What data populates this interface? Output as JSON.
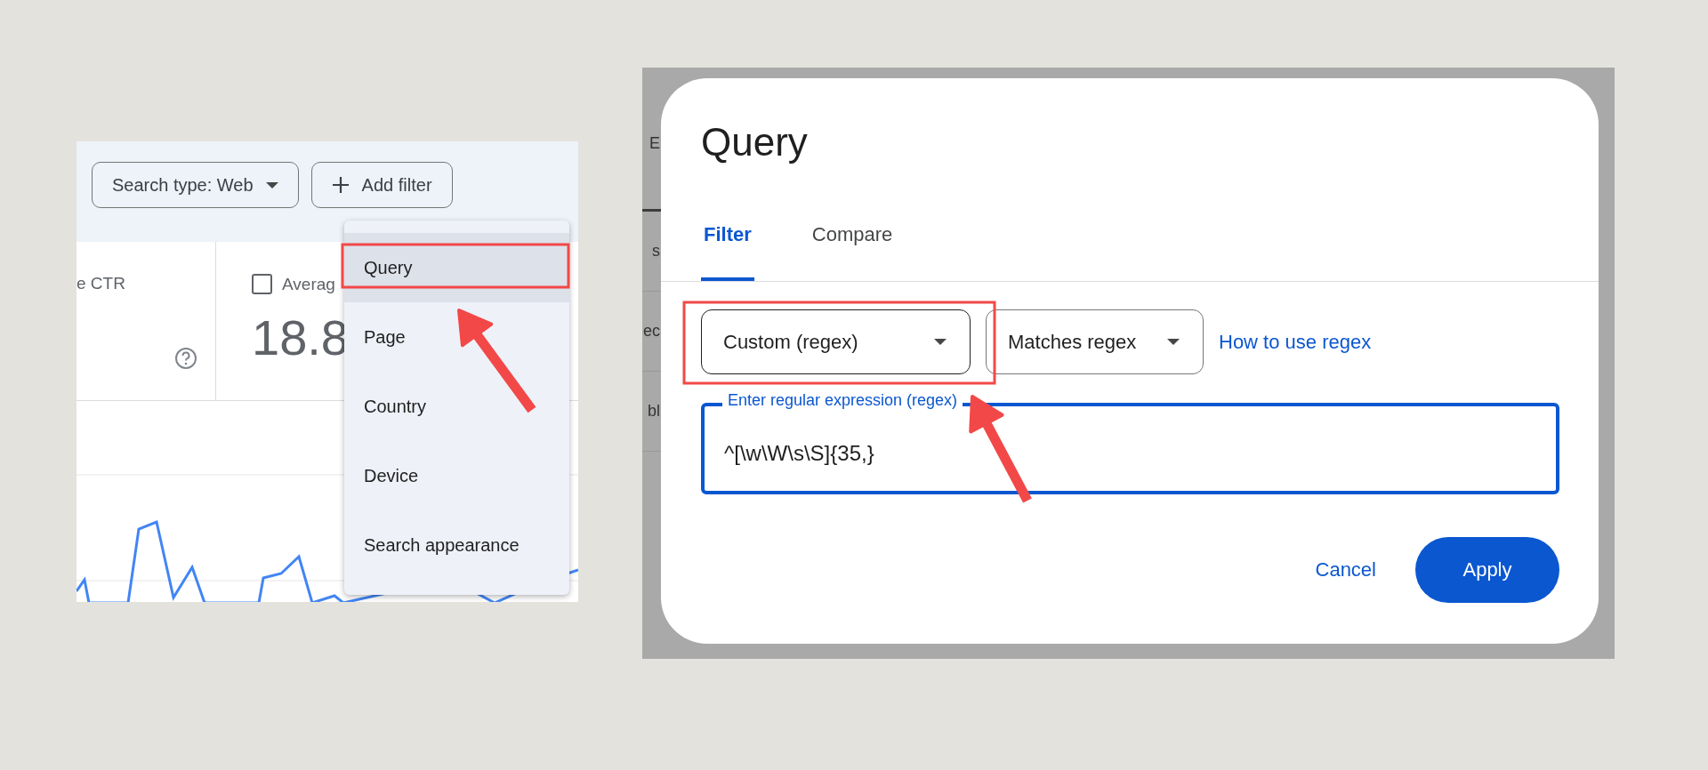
{
  "left_panel": {
    "toolbar": {
      "search_type": "Search type: Web",
      "add_filter": "Add filter"
    },
    "metrics": [
      {
        "kind": "help",
        "label": "e CTR"
      },
      {
        "kind": "checkbox",
        "label": "Averag",
        "value": "18.8",
        "checked": false
      }
    ],
    "menu": {
      "items": [
        {
          "label": "Query",
          "selected": true
        },
        {
          "label": "Page",
          "selected": false
        },
        {
          "label": "Country",
          "selected": false
        },
        {
          "label": "Device",
          "selected": false
        },
        {
          "label": "Search appearance",
          "selected": false
        }
      ]
    }
  },
  "right_panel": {
    "background_rows": [
      "E",
      "s",
      "ec",
      "bl"
    ],
    "dialog": {
      "title": "Query",
      "tabs": [
        {
          "label": "Filter",
          "selected": true
        },
        {
          "label": "Compare",
          "selected": false
        }
      ],
      "match_type": "Custom (regex)",
      "operator": "Matches regex",
      "help_link": "How to use regex",
      "field": {
        "label": "Enter regular expression (regex)",
        "value": "^[\\w\\W\\s\\S]{35,}"
      },
      "buttons": {
        "cancel": "Cancel",
        "apply": "Apply"
      }
    }
  }
}
